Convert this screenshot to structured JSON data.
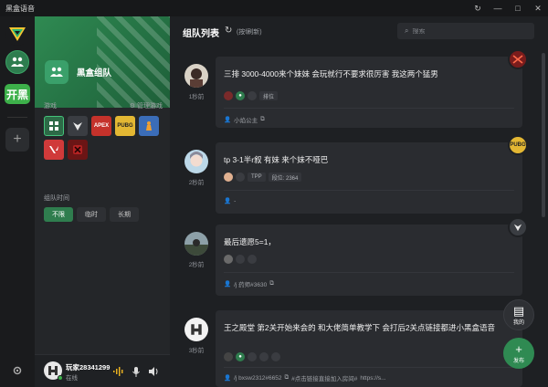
{
  "window": {
    "title": "黑盒语音",
    "controls": [
      "↻",
      "—",
      "□",
      "✕"
    ]
  },
  "rail": {
    "kai_label": "开黑",
    "add_label": "+"
  },
  "group": {
    "name": "黑盒组队",
    "games_label": "游戏",
    "manage_label": "管理游戏",
    "games": [
      {
        "name": "all",
        "text": ""
      },
      {
        "name": "destiny",
        "text": ""
      },
      {
        "name": "apex",
        "text": "APEX"
      },
      {
        "name": "pubg",
        "text": "PUBG"
      },
      {
        "name": "csgo",
        "text": ""
      },
      {
        "name": "valorant",
        "text": ""
      },
      {
        "name": "dota",
        "text": ""
      }
    ],
    "time_label": "组队时间",
    "time_options": [
      "不限",
      "临时",
      "长期"
    ]
  },
  "user": {
    "name": "玩家28341299",
    "status": "在线"
  },
  "main": {
    "title": "组队列表",
    "refresh_hint": "(按f刷新)",
    "search_placeholder": "搜索"
  },
  "posts": [
    {
      "time": "1秒前",
      "text": "三排 3000-4000来个妹妹 会玩就行不要求很厉害 我这两个猛男",
      "tags": [
        "",
        "",
        "",
        "排位"
      ],
      "owner": "小焰公主",
      "badge": {
        "game": "dota",
        "color": "#6b1515"
      }
    },
    {
      "time": "2秒前",
      "text": "tp 3-1半r叙 有妹 来个妹不哑巴",
      "tags": [
        "",
        "",
        "TPP",
        "段位: 2364"
      ],
      "owner": "-",
      "badge": {
        "game": "pubg",
        "color": "#e3b733"
      }
    },
    {
      "time": "2秒前",
      "text": "最后遗愿5=1，",
      "tags": [
        "",
        "",
        ""
      ],
      "owner": "/j 药师#3630",
      "badge": {
        "game": "destiny",
        "color": "#3a3d42"
      }
    },
    {
      "time": "3秒前",
      "text": "王之殿堂 第2关开始来会的 和大佬简单教学下 会打后2关点链接都进小黑盒语音",
      "tags": [
        "",
        "",
        "",
        "",
        ""
      ],
      "owner": "/j bxsw2312#6652",
      "link": "#点击链接直接加入房间#",
      "extra": "https://s..."
    }
  ],
  "fab": {
    "mine_label": "我的",
    "post_label": "发布"
  }
}
